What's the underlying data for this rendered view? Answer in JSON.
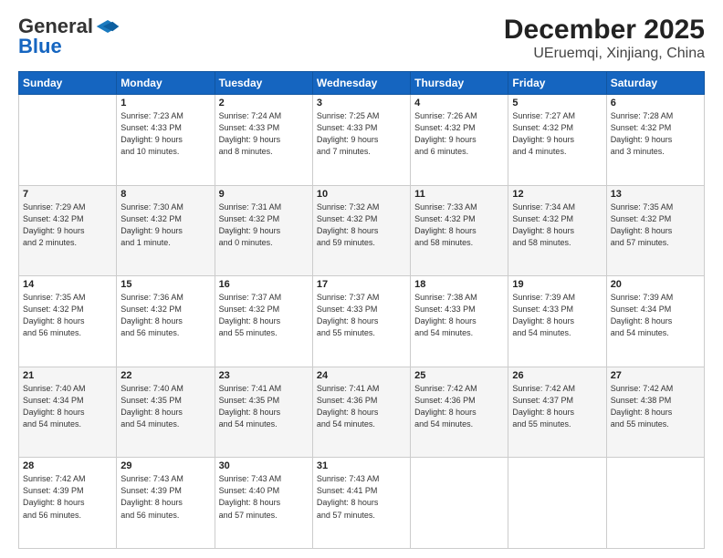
{
  "logo": {
    "general": "General",
    "blue": "Blue",
    "tagline": ""
  },
  "title": "December 2025",
  "subtitle": "UEruemqi, Xinjiang, China",
  "days_header": [
    "Sunday",
    "Monday",
    "Tuesday",
    "Wednesday",
    "Thursday",
    "Friday",
    "Saturday"
  ],
  "weeks": [
    [
      {
        "day": "",
        "content": ""
      },
      {
        "day": "1",
        "content": "Sunrise: 7:23 AM\nSunset: 4:33 PM\nDaylight: 9 hours\nand 10 minutes."
      },
      {
        "day": "2",
        "content": "Sunrise: 7:24 AM\nSunset: 4:33 PM\nDaylight: 9 hours\nand 8 minutes."
      },
      {
        "day": "3",
        "content": "Sunrise: 7:25 AM\nSunset: 4:33 PM\nDaylight: 9 hours\nand 7 minutes."
      },
      {
        "day": "4",
        "content": "Sunrise: 7:26 AM\nSunset: 4:32 PM\nDaylight: 9 hours\nand 6 minutes."
      },
      {
        "day": "5",
        "content": "Sunrise: 7:27 AM\nSunset: 4:32 PM\nDaylight: 9 hours\nand 4 minutes."
      },
      {
        "day": "6",
        "content": "Sunrise: 7:28 AM\nSunset: 4:32 PM\nDaylight: 9 hours\nand 3 minutes."
      }
    ],
    [
      {
        "day": "7",
        "content": "Sunrise: 7:29 AM\nSunset: 4:32 PM\nDaylight: 9 hours\nand 2 minutes."
      },
      {
        "day": "8",
        "content": "Sunrise: 7:30 AM\nSunset: 4:32 PM\nDaylight: 9 hours\nand 1 minute."
      },
      {
        "day": "9",
        "content": "Sunrise: 7:31 AM\nSunset: 4:32 PM\nDaylight: 9 hours\nand 0 minutes."
      },
      {
        "day": "10",
        "content": "Sunrise: 7:32 AM\nSunset: 4:32 PM\nDaylight: 8 hours\nand 59 minutes."
      },
      {
        "day": "11",
        "content": "Sunrise: 7:33 AM\nSunset: 4:32 PM\nDaylight: 8 hours\nand 58 minutes."
      },
      {
        "day": "12",
        "content": "Sunrise: 7:34 AM\nSunset: 4:32 PM\nDaylight: 8 hours\nand 58 minutes."
      },
      {
        "day": "13",
        "content": "Sunrise: 7:35 AM\nSunset: 4:32 PM\nDaylight: 8 hours\nand 57 minutes."
      }
    ],
    [
      {
        "day": "14",
        "content": "Sunrise: 7:35 AM\nSunset: 4:32 PM\nDaylight: 8 hours\nand 56 minutes."
      },
      {
        "day": "15",
        "content": "Sunrise: 7:36 AM\nSunset: 4:32 PM\nDaylight: 8 hours\nand 56 minutes."
      },
      {
        "day": "16",
        "content": "Sunrise: 7:37 AM\nSunset: 4:32 PM\nDaylight: 8 hours\nand 55 minutes."
      },
      {
        "day": "17",
        "content": "Sunrise: 7:37 AM\nSunset: 4:33 PM\nDaylight: 8 hours\nand 55 minutes."
      },
      {
        "day": "18",
        "content": "Sunrise: 7:38 AM\nSunset: 4:33 PM\nDaylight: 8 hours\nand 54 minutes."
      },
      {
        "day": "19",
        "content": "Sunrise: 7:39 AM\nSunset: 4:33 PM\nDaylight: 8 hours\nand 54 minutes."
      },
      {
        "day": "20",
        "content": "Sunrise: 7:39 AM\nSunset: 4:34 PM\nDaylight: 8 hours\nand 54 minutes."
      }
    ],
    [
      {
        "day": "21",
        "content": "Sunrise: 7:40 AM\nSunset: 4:34 PM\nDaylight: 8 hours\nand 54 minutes."
      },
      {
        "day": "22",
        "content": "Sunrise: 7:40 AM\nSunset: 4:35 PM\nDaylight: 8 hours\nand 54 minutes."
      },
      {
        "day": "23",
        "content": "Sunrise: 7:41 AM\nSunset: 4:35 PM\nDaylight: 8 hours\nand 54 minutes."
      },
      {
        "day": "24",
        "content": "Sunrise: 7:41 AM\nSunset: 4:36 PM\nDaylight: 8 hours\nand 54 minutes."
      },
      {
        "day": "25",
        "content": "Sunrise: 7:42 AM\nSunset: 4:36 PM\nDaylight: 8 hours\nand 54 minutes."
      },
      {
        "day": "26",
        "content": "Sunrise: 7:42 AM\nSunset: 4:37 PM\nDaylight: 8 hours\nand 55 minutes."
      },
      {
        "day": "27",
        "content": "Sunrise: 7:42 AM\nSunset: 4:38 PM\nDaylight: 8 hours\nand 55 minutes."
      }
    ],
    [
      {
        "day": "28",
        "content": "Sunrise: 7:42 AM\nSunset: 4:39 PM\nDaylight: 8 hours\nand 56 minutes."
      },
      {
        "day": "29",
        "content": "Sunrise: 7:43 AM\nSunset: 4:39 PM\nDaylight: 8 hours\nand 56 minutes."
      },
      {
        "day": "30",
        "content": "Sunrise: 7:43 AM\nSunset: 4:40 PM\nDaylight: 8 hours\nand 57 minutes."
      },
      {
        "day": "31",
        "content": "Sunrise: 7:43 AM\nSunset: 4:41 PM\nDaylight: 8 hours\nand 57 minutes."
      },
      {
        "day": "",
        "content": ""
      },
      {
        "day": "",
        "content": ""
      },
      {
        "day": "",
        "content": ""
      }
    ]
  ]
}
